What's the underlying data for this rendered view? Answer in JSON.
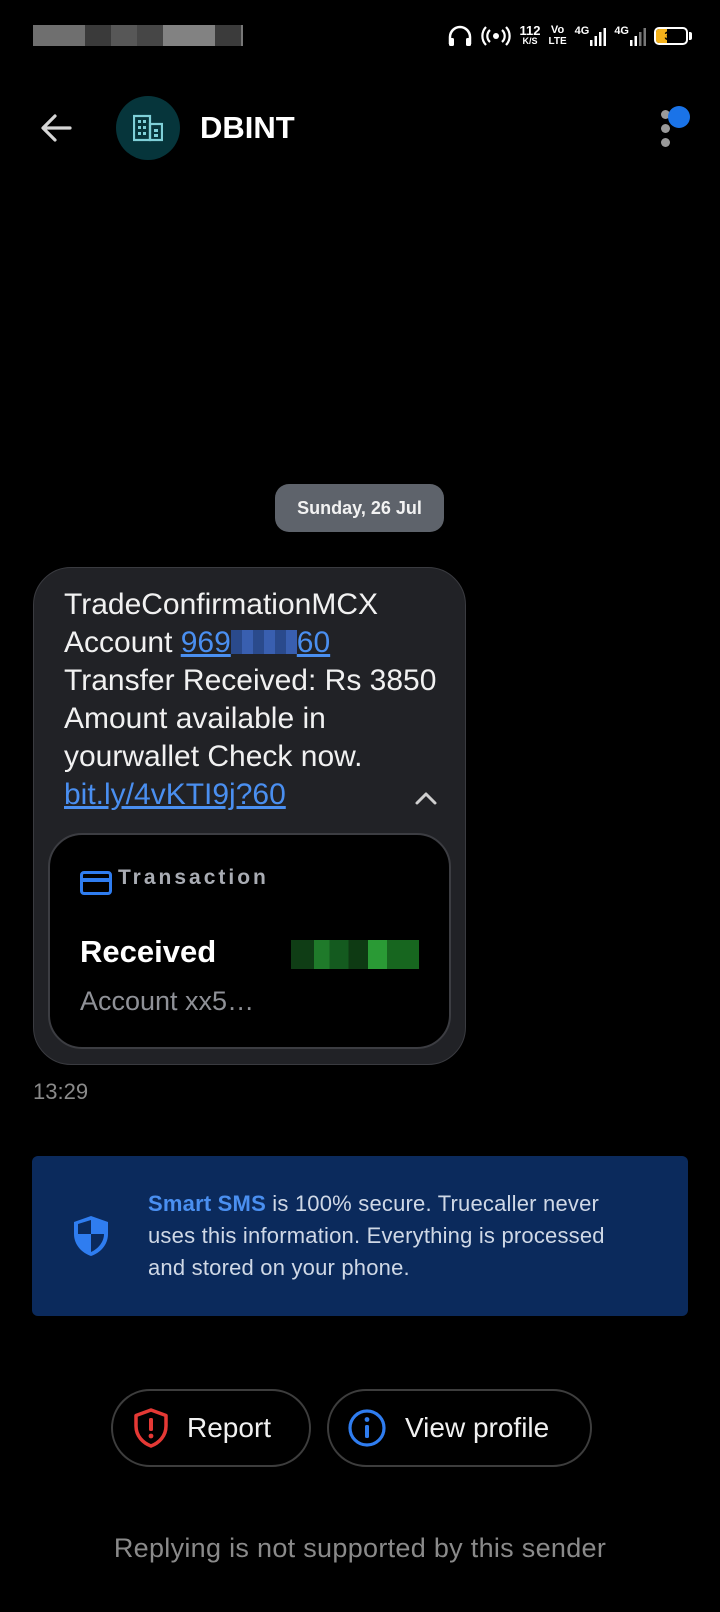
{
  "status_bar": {
    "net_speed_value": "112",
    "net_speed_unit": "K/S",
    "volte_top": "Vo",
    "volte_bottom": "LTE",
    "sim1_type": "4G",
    "sim2_type": "4G",
    "battery_level": "36",
    "battery_fraction": 0.36,
    "icons": [
      "headphones-icon",
      "hotspot-icon",
      "signal-icon",
      "battery-icon"
    ]
  },
  "header": {
    "sender_name": "DBINT",
    "avatar_icon": "business-icon",
    "back_icon": "back-arrow-icon",
    "menu_icon": "more-vert-icon"
  },
  "conversation": {
    "date_chip": "Sunday, 26 Jul",
    "message": {
      "line1": "TradeConfirmationMCX",
      "account_prefix": "Account ",
      "account_link_start": "969",
      "account_link_end": "60",
      "body": "Transfer Received: Rs 3850 Amount available in yourwallet Check now.",
      "url": "bit.ly/4vKTI9j?60"
    },
    "transaction_card": {
      "label": "Transaction",
      "title": "Received",
      "account": "Account xx5…"
    },
    "time": "13:29"
  },
  "smart_sms_banner": {
    "brand": "Smart SMS",
    "text": " is 100% secure. Truecaller never uses this information. Everything is processed and stored on your phone."
  },
  "actions": {
    "report_label": "Report",
    "view_profile_label": "View profile"
  },
  "footer_note": "Replying is not supported by this sender",
  "colors": {
    "accent": "#1a73e8",
    "link": "#4a8ff0",
    "banner_bg": "#0b2a5c",
    "report_red": "#e53935",
    "battery": "#f5b21a"
  }
}
